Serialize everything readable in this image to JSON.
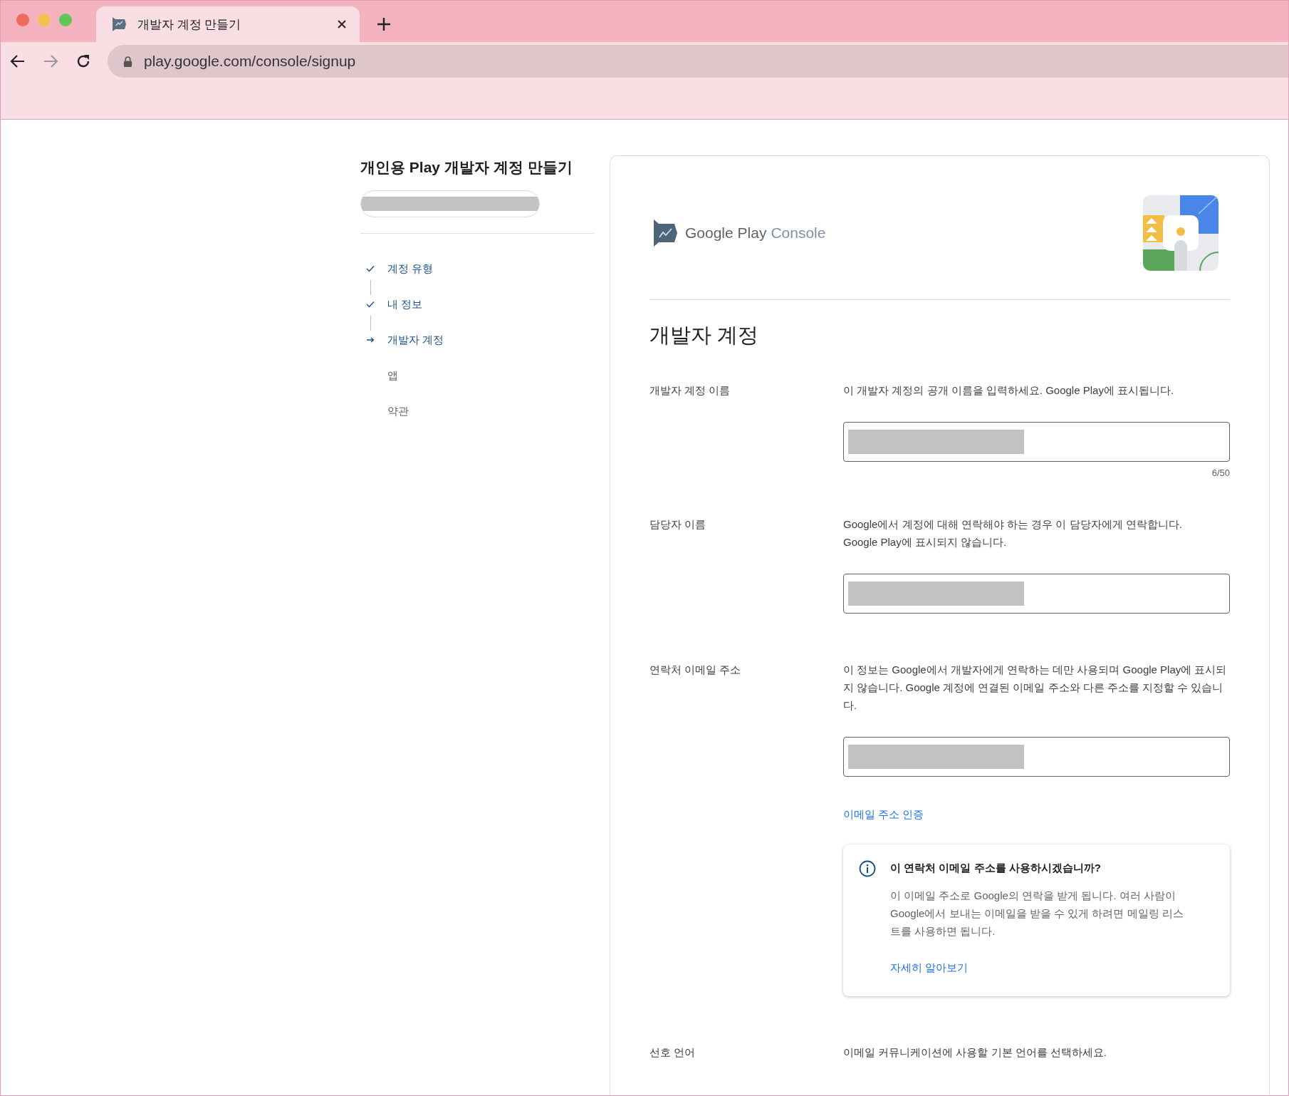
{
  "browser": {
    "tab_title": "개발자 계정 만들기",
    "url": "play.google.com/console/signup"
  },
  "sidebar": {
    "title": "개인용 Play 개발자 계정 만들기",
    "steps": [
      {
        "label": "계정 유형",
        "kind": "done"
      },
      {
        "label": "내 정보",
        "kind": "done"
      },
      {
        "label": "개발자 계정",
        "kind": "current"
      },
      {
        "label": "앱",
        "kind": "pending"
      },
      {
        "label": "약관",
        "kind": "pending"
      }
    ]
  },
  "card": {
    "brand": "Google Play",
    "product": "Console",
    "heading": "개발자 계정",
    "rows": [
      {
        "kind": "input",
        "label": "개발자 계정 이름",
        "description": "이 개발자 계정의 공개 이름을 입력하세요. Google Play에 표시됩니다.",
        "counter": "6/50"
      },
      {
        "kind": "input",
        "label": "담당자 이름",
        "description": "Google에서 계정에 대해 연락해야 하는 경우 이 담당자에게 연락합니다.\nGoogle Play에 표시되지 않습니다."
      },
      {
        "kind": "input",
        "label": "연락처 이메일 주소",
        "description": "이 정보는 Google에서 개발자에게 연락하는 데만 사용되며 Google Play에 표시되지 않습니다. Google 계정에 연결된 이메일 주소와 다른 주소를 지정할 수 있습니다.",
        "link": "이메일 주소 인증",
        "notice": {
          "title": "이 연락처 이메일 주소를 사용하시겠습니까?",
          "body": "이 이메일 주소로 Google의 연락을 받게 됩니다. 여러 사람이 Google에서 보내는 이메일을 받을 수 있게 하려면 메일링 리스트를 사용하면 됩니다.",
          "link": "자세히 알아보기"
        }
      },
      {
        "kind": "text",
        "label": "선호 언어",
        "description": "이메일 커뮤니케이션에 사용할 기본 언어를 선택하세요."
      }
    ]
  }
}
